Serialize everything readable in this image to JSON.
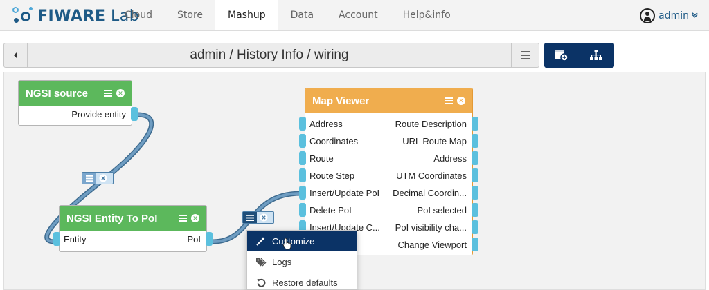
{
  "brand": {
    "name_bold": "FIWARE",
    "name_rest": " Lab"
  },
  "nav": {
    "tabs": [
      {
        "label": "Cloud",
        "active": false
      },
      {
        "label": "Store",
        "active": false
      },
      {
        "label": "Mashup",
        "active": true
      },
      {
        "label": "Data",
        "active": false
      },
      {
        "label": "Account",
        "active": false
      },
      {
        "label": "Help&info",
        "active": false
      }
    ],
    "user": "admin"
  },
  "path": {
    "title": "admin / History Info / wiring"
  },
  "widgets": {
    "ngsi_source": {
      "title": "NGSI source",
      "outputs": [
        "Provide entity"
      ]
    },
    "ngsi_entity_to_poi": {
      "title": "NGSI Entity To PoI",
      "input": "Entity",
      "output": "PoI"
    },
    "map_viewer": {
      "title": "Map Viewer",
      "rows": [
        {
          "in": "Address",
          "out": "Route Description"
        },
        {
          "in": "Coordinates",
          "out": "URL Route Map"
        },
        {
          "in": "Route",
          "out": "Address"
        },
        {
          "in": "Route Step",
          "out": "UTM Coordinates"
        },
        {
          "in": "Insert/Update PoI",
          "out": "Decimal Coordin..."
        },
        {
          "in": "Delete PoI",
          "out": "PoI selected"
        },
        {
          "in": "Insert/Update C...",
          "out": "PoI visibility cha..."
        },
        {
          "in": "",
          "out": "Change Viewport"
        }
      ]
    }
  },
  "context_menu": {
    "items": [
      {
        "label": "Customize",
        "icon": "magic-wand-icon",
        "active": true
      },
      {
        "label": "Logs",
        "icon": "tags-icon",
        "active": false
      },
      {
        "label": "Restore defaults",
        "icon": "undo-icon",
        "active": false
      }
    ]
  },
  "colors": {
    "accent": "#0b3366",
    "brand": "#1e5a86",
    "operator_header": "#5cb85c",
    "widget_header": "#f0ad4e",
    "endpoint": "#5bc0de",
    "wire": "#4d7fa8"
  }
}
